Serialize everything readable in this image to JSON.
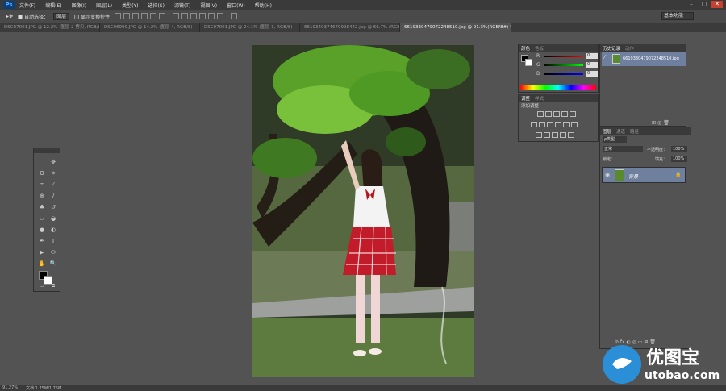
{
  "app": {
    "logo": "Ps",
    "menu": [
      "文件(F)",
      "编辑(E)",
      "图像(I)",
      "图层(L)",
      "类型(Y)",
      "选择(S)",
      "滤镜(T)",
      "视图(V)",
      "窗口(W)",
      "帮助(H)"
    ]
  },
  "options_bar": {
    "auto_select_label": "自动选择：",
    "auto_select_target": "图层",
    "transform_controls_label": "显示变换控件",
    "workspace": "基本功能"
  },
  "tabs": [
    {
      "label": "DSC07001.JPG @ 12.2% (图层 2 拷贝, RGB/8)",
      "active": false
    },
    {
      "label": "DSC06999.JPG @ 14.2% (图层 4, RGB/8)",
      "active": false
    },
    {
      "label": "DSC07001.JPG @ 24.1% (图层 1, RGB/8)",
      "active": false
    },
    {
      "label": "6619340374679998442.jpg @ 66.7% (RGB/8)",
      "active": false
    },
    {
      "label": "661933047907224851​0.jpg @ 91.3%(RGB/8#) *",
      "active": true
    }
  ],
  "color_panel": {
    "tabs": [
      "颜色",
      "色板"
    ],
    "r": "0",
    "g": "0",
    "b": "0",
    "labels": [
      "R",
      "G",
      "B"
    ]
  },
  "adjustments_panel": {
    "tabs": [
      "调整",
      "样式"
    ],
    "title": "添加调整"
  },
  "history_panel": {
    "tabs": [
      "历史记录",
      "动作"
    ],
    "snapshot": "661933047907224851​0.jpg"
  },
  "layers_panel": {
    "tabs": [
      "图层",
      "通道",
      "路径"
    ],
    "filter": "ρ类型",
    "blend_mode": "正常",
    "opacity_label": "不透明度：",
    "opacity": "100%",
    "lock_label": "锁定：",
    "fill_label": "填充：",
    "fill": "100%",
    "layers": [
      {
        "name": "背景",
        "selected": true
      }
    ]
  },
  "status_bar": {
    "zoom": "91.27%",
    "doc": "文档:1.75M/1.75M"
  },
  "brand": {
    "name": "优图宝",
    "url": "utobao.com"
  },
  "colors": {
    "accent": "#6f7f9e",
    "brand_blue": "#2a8fd6"
  }
}
